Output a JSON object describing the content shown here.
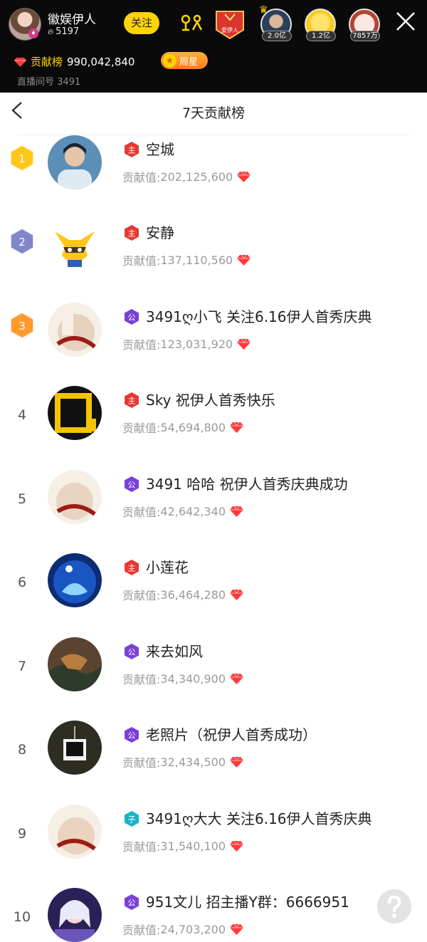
{
  "header": {
    "host_name": "徽娱伊人",
    "host_fans": "5197",
    "follow_label": "关注",
    "fan_group_label": "爱伊人",
    "viewers": [
      {
        "tag": "2.0亿"
      },
      {
        "tag": "1.2亿"
      },
      {
        "tag": "7857万"
      }
    ],
    "contribution_label": "贡献榜",
    "contribution_value": "990,042,840",
    "week_star_label": "周星",
    "room_no_label": "直播间号",
    "room_no": "3491"
  },
  "panel": {
    "title": "7天贡献榜"
  },
  "score_prefix": "贡献值:",
  "ranking": [
    {
      "rank": "1",
      "badge": "主",
      "name": "空城",
      "score": "202,125,600"
    },
    {
      "rank": "2",
      "badge": "主",
      "name": "安静",
      "score": "137,110,560"
    },
    {
      "rank": "3",
      "badge": "公",
      "name": "3491ღ小飞 关注6.16伊人首秀庆典",
      "score": "123,031,920"
    },
    {
      "rank": "4",
      "badge": "主",
      "name": "Sky 祝伊人首秀快乐",
      "score": "54,694,800"
    },
    {
      "rank": "5",
      "badge": "公",
      "name": "3491 哈哈 祝伊人首秀庆典成功",
      "score": "42,642,340"
    },
    {
      "rank": "6",
      "badge": "主",
      "name": "小莲花",
      "score": "36,464,280"
    },
    {
      "rank": "7",
      "badge": "公",
      "name": "来去如风",
      "score": "34,340,900"
    },
    {
      "rank": "8",
      "badge": "公",
      "name": "老照片（祝伊人首秀成功）",
      "score": "32,434,500"
    },
    {
      "rank": "9",
      "badge": "子",
      "name": "3491ღ大大 关注6.16伊人首秀庆典",
      "score": "31,540,100"
    },
    {
      "rank": "10",
      "badge": "公",
      "name": "951文儿  招主播Y群：6666951",
      "score": "24,703,200"
    }
  ],
  "colors": {
    "accent_yellow": "#ffd400",
    "gem_red": "#ff3b3b",
    "badge_main": "#e53935",
    "badge_public": "#7b3fd9",
    "badge_child": "#18b4c9",
    "medal_gold": "#ffc61a",
    "medal_silver": "#7f86c9",
    "medal_bronze": "#ff9a2e"
  },
  "icons": {
    "back": "chevron-left-icon",
    "close": "close-icon",
    "gem": "diamond-icon",
    "help": "question-icon",
    "link": "link-mic-icon"
  }
}
